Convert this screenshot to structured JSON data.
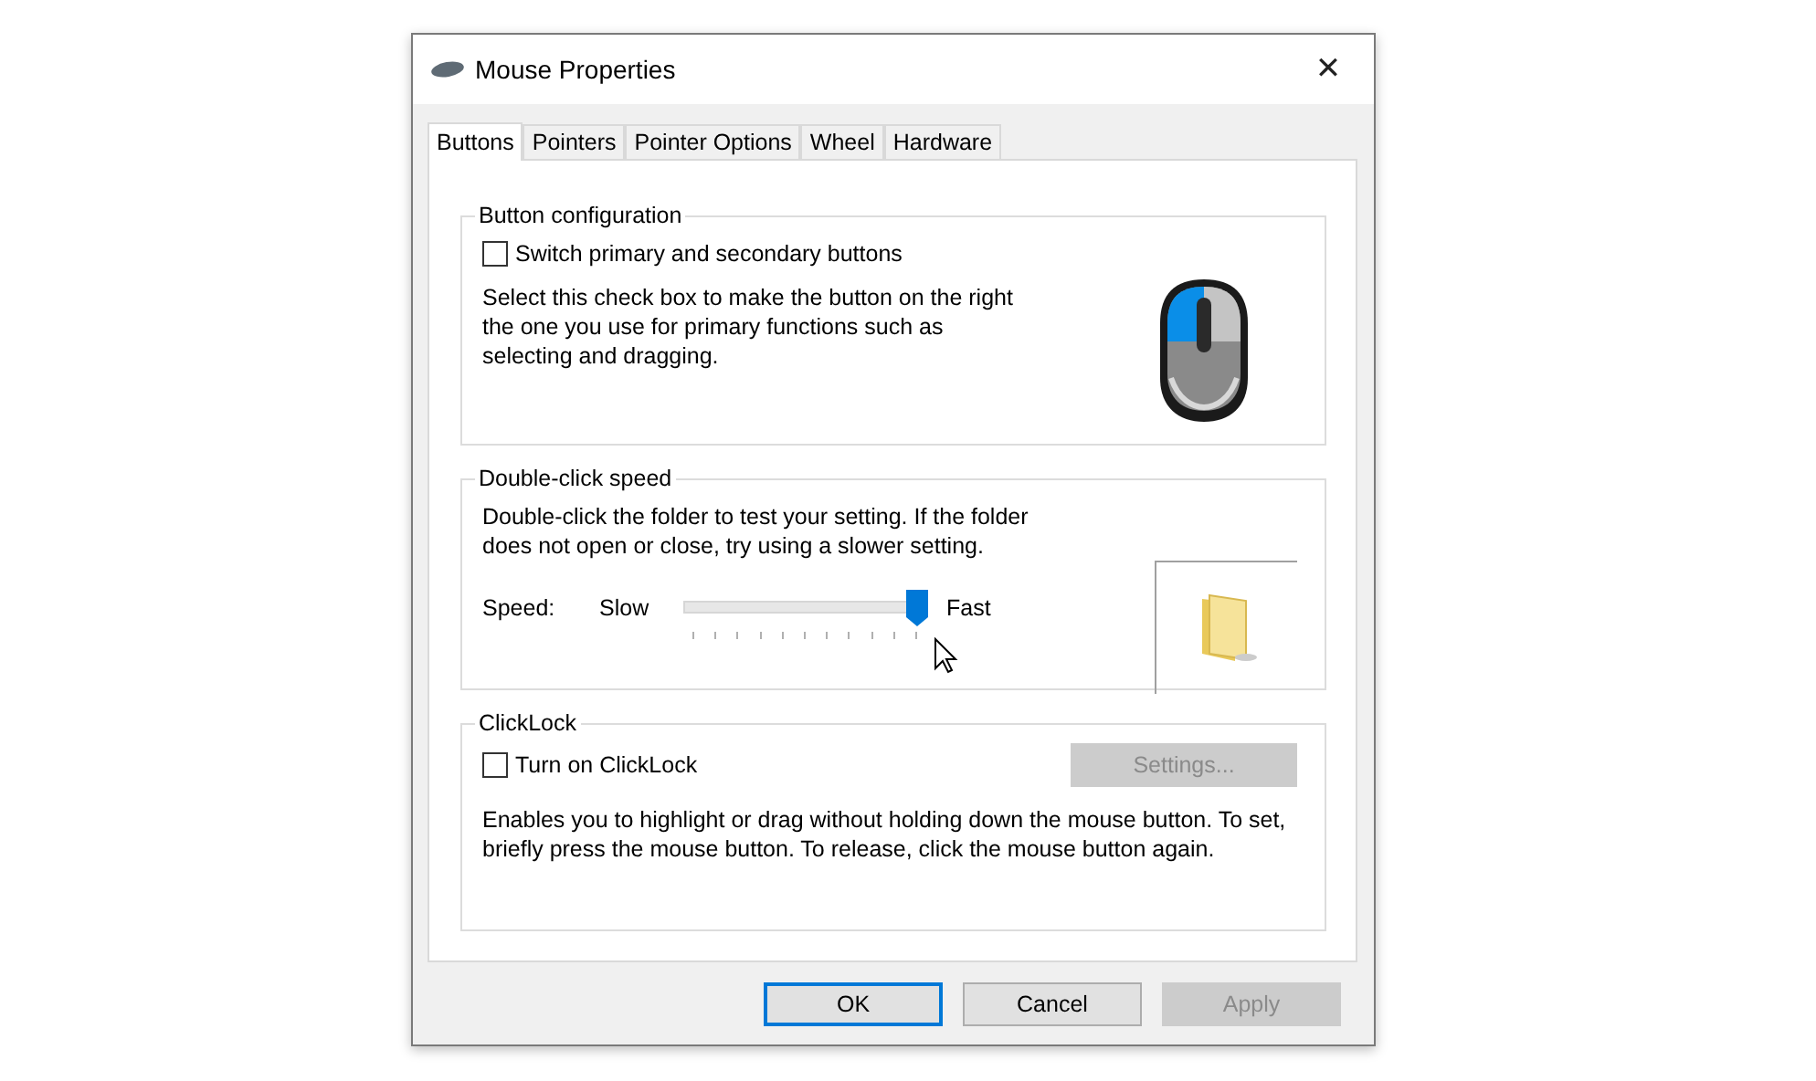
{
  "window": {
    "title": "Mouse Properties",
    "close": "✕"
  },
  "tabs": [
    {
      "label": "Buttons",
      "selected": true
    },
    {
      "label": "Pointers",
      "selected": false
    },
    {
      "label": "Pointer Options",
      "selected": false
    },
    {
      "label": "Wheel",
      "selected": false
    },
    {
      "label": "Hardware",
      "selected": false
    }
  ],
  "button_configuration": {
    "title": "Button configuration",
    "checkbox": {
      "label": "Switch primary and secondary buttons",
      "checked": false
    },
    "description": "Select this check box to make the button on the right the one you use for primary functions such as selecting and dragging."
  },
  "double_click_speed": {
    "title": "Double-click speed",
    "description": "Double-click the folder to test your setting. If the folder does not open or close, try using a slower setting.",
    "speed_label": "Speed:",
    "slow_label": "Slow",
    "fast_label": "Fast",
    "slider": {
      "level": 1
    }
  },
  "clicklock": {
    "title": "ClickLock",
    "checkbox": {
      "label": "Turn on ClickLock",
      "checked": false
    },
    "settings_button": {
      "label": "Settings...",
      "disabled": true
    },
    "description": "Enables you to highlight or drag without holding down the mouse button. To set, briefly press the mouse button. To release, click the mouse button again."
  },
  "buttons": [
    {
      "label": "OK",
      "default": true,
      "disabled": false
    },
    {
      "label": "Cancel",
      "default": false,
      "disabled": false
    },
    {
      "label": "Apply",
      "default": false,
      "disabled": true
    }
  ]
}
